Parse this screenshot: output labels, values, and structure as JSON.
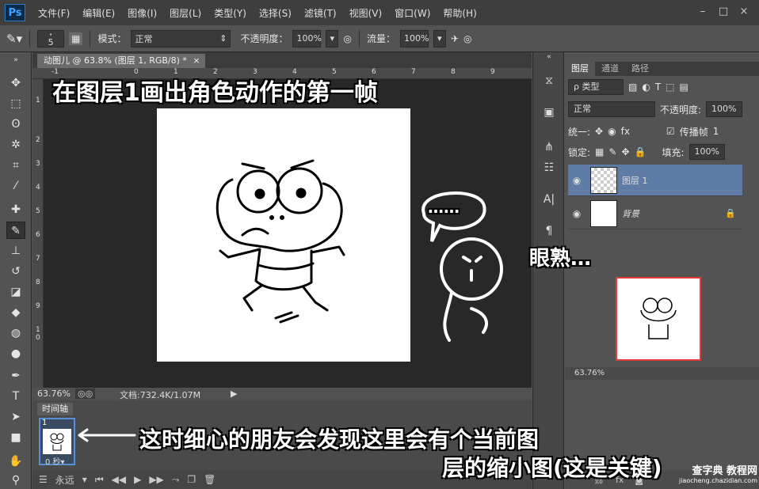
{
  "app": {
    "logo": "Ps"
  },
  "menu": [
    "文件(F)",
    "编辑(E)",
    "图像(I)",
    "图层(L)",
    "类型(Y)",
    "选择(S)",
    "滤镜(T)",
    "视图(V)",
    "窗口(W)",
    "帮助(H)"
  ],
  "window_controls": [
    "–",
    "□",
    "×"
  ],
  "options": {
    "brush_size": "5",
    "mode_label": "模式：",
    "mode_value": "正常",
    "opacity_label": "不透明度：",
    "opacity_value": "100%",
    "flow_label": "流量：",
    "flow_value": "100%"
  },
  "document": {
    "tab_title": "动图儿 @ 63.8% (图层 1, RGB/8) *",
    "close": "×",
    "ruler_top": [
      "-1",
      "0",
      "1",
      "2",
      "3",
      "4",
      "5",
      "6",
      "7",
      "8",
      "9"
    ],
    "ruler_left": [
      "1",
      "2",
      "3",
      "4",
      "5",
      "6",
      "7",
      "8",
      "9",
      "1",
      "0"
    ]
  },
  "status": {
    "zoom": "63.76%",
    "doc_size": "文档:732.4K/1.07M"
  },
  "timeline": {
    "tab": "时间轴",
    "frame_number": "1",
    "frame_delay": "0 秒▾",
    "loop": "永远"
  },
  "layers_panel": {
    "tabs": [
      "图层",
      "通道",
      "路径"
    ],
    "filter_label": "ρ 类型",
    "blend_mode": "正常",
    "opacity_label": "不透明度:",
    "opacity_value": "100%",
    "unify_label": "统一:",
    "propagate_label": "传播帧",
    "propagate_value": "1",
    "lock_label": "锁定:",
    "fill_label": "填充:",
    "fill_value": "100%",
    "layers": [
      {
        "name": "图层 1",
        "selected": true
      },
      {
        "name": "背景",
        "selected": false
      }
    ]
  },
  "navigator": {
    "zoom": "63.76%"
  },
  "annotations": {
    "title": "在图层1画出角色动作的第一帧",
    "bubble_dots": "……",
    "bubble_text": "眼熟…",
    "bottom_line1": "这时细心的朋友会发现这里会有个当前图",
    "bottom_line2": "层的缩小图(这是关键)"
  },
  "watermark": {
    "line1": "查字典 教程网",
    "line2": "jiaocheng.chazidian.com"
  }
}
